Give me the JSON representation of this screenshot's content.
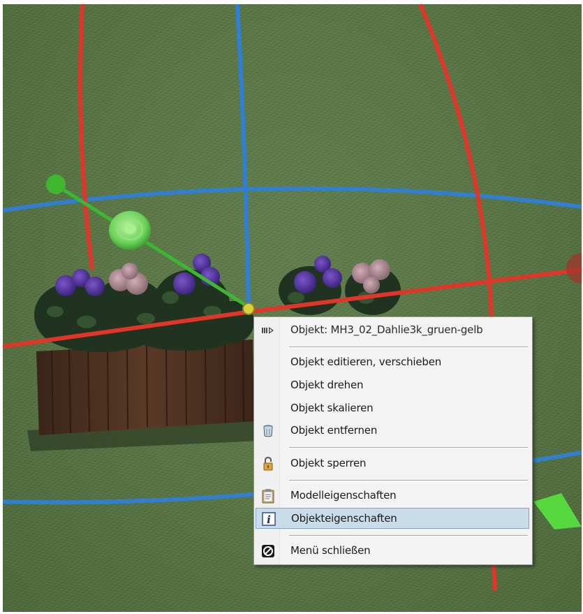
{
  "menu": {
    "header": {
      "label": "Objekt: MH3_02_Dahlie3k_gruen-gelb",
      "icon": "arrow-right-icon"
    },
    "items": [
      {
        "label": "Objekt editieren, verschieben",
        "icon": ""
      },
      {
        "label": "Objekt drehen",
        "icon": ""
      },
      {
        "label": "Objekt skalieren",
        "icon": ""
      },
      {
        "label": "Objekt entfernen",
        "icon": "trash-can-icon"
      },
      {
        "label": "Objekt sperren",
        "icon": "lock-icon"
      },
      {
        "label": "Modelleigenschaften",
        "icon": "clipboard-icon"
      },
      {
        "label": "Objekteigenschaften",
        "icon": "info-icon",
        "highlighted": true
      },
      {
        "label": "Menü schließen",
        "icon": "no-entry-icon"
      }
    ]
  },
  "scene": {
    "background_color": "#5a7745",
    "gizmo_colors": {
      "x_axis": "#e0362a",
      "y_axis": "#2f7fd6",
      "z_axis": "#3cb830"
    },
    "selection_highlight": "#c9dcea"
  }
}
